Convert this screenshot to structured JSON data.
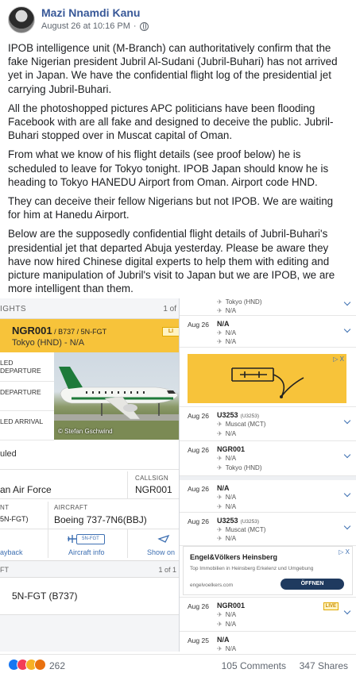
{
  "post": {
    "author": "Mazi Nnamdi Kanu",
    "timestamp": "August 26 at 10:16 PM",
    "paragraphs": [
      "IPOB intelligence unit (M-Branch) can authoritatively confirm that the fake Nigerian president Jubril Al-Sudani (Jubril-Buhari) has not arrived yet in Japan. We have the confidential flight log of the presidential jet carrying Jubril-Buhari.",
      "All the photoshopped pictures APC politicians have been flooding Facebook with are all fake and designed to deceive the public. Jubril-Buhari stopped over in Muscat capital of Oman.",
      "From what we know of his flight details (see proof below) he is scheduled to leave for Tokyo tonight. IPOB Japan should know he is heading to Tokyo HANEDU Airport from Oman. Airport code HND.",
      "They can deceive their fellow Nigerians but not IPOB. We are waiting for him at Hanedu Airport.",
      "Below are the supposedly confidential flight details of Jubril-Buhari's presidential jet that departed Abuja yesterday. Please be aware they have now hired Chinese digital experts to help them with editing and picture manipulation of Jubril's visit to Japan but we are IPOB, we are more intelligent than them."
    ]
  },
  "left_panel": {
    "header_left": "IGHTS",
    "header_right": "1 of",
    "callsign_main": "NGR001",
    "callsign_sub": " / B737 / 5N-FGT",
    "route": "Tokyo (HND) - N/A",
    "live_tag": "LI",
    "time_labels": [
      "LED DEPARTURE",
      "DEPARTURE",
      "LED ARRIVAL"
    ],
    "photo_credit": "© Stefan Gschwind",
    "status": "uled",
    "airline": "an Air Force",
    "callsign_label": "CALLSIGN",
    "callsign_value": "NGR001",
    "nt_label": "NT",
    "nt_value": "5N-FGT)",
    "aircraft_label": "AIRCRAFT",
    "aircraft_value": "Boeing 737-7N6(BBJ)",
    "tab_playback": "ayback",
    "tab_aircraft_info": "Aircraft info",
    "tab_aircraft_icon_text": "5N-FGT",
    "tab_show_on": "Show on",
    "header2_left": "FT",
    "header2_right": "1 of 1",
    "registration": "5N-FGT (B737)"
  },
  "right_panel": {
    "items": [
      {
        "date": "",
        "flight": "",
        "sub": "",
        "lines": [
          "Tokyo (HND)",
          "N/A"
        ]
      },
      {
        "date": "Aug 26",
        "flight": "N/A",
        "sub": "",
        "lines": [
          "N/A",
          "N/A"
        ]
      },
      {
        "date": "Aug 26",
        "flight": "U3253",
        "sub": "(U3253)",
        "lines": [
          "Muscat (MCT)",
          "N/A"
        ]
      },
      {
        "date": "Aug 26",
        "flight": "NGR001",
        "sub": "",
        "lines": [
          "N/A",
          "Tokyo (HND)"
        ]
      },
      {
        "date": "Aug 26",
        "flight": "N/A",
        "sub": "",
        "lines": [
          "N/A",
          "N/A"
        ]
      },
      {
        "date": "Aug 26",
        "flight": "U3253",
        "sub": "(U3253)",
        "lines": [
          "Muscat (MCT)",
          "N/A"
        ]
      },
      {
        "date": "Aug 26",
        "flight": "NGR001",
        "sub": "",
        "lines": [
          "N/A",
          "N/A"
        ],
        "live": "LIVE"
      },
      {
        "date": "Aug 25",
        "flight": "N/A",
        "sub": "",
        "lines": [
          "N/A"
        ]
      }
    ],
    "ad_title": "Engel&Völkers Heinsberg",
    "ad_text": "Top Immobilien in Heinsberg Erkelenz und Umgebung",
    "ad_domain": "engelvoelkers.com",
    "ad_button": "ÖFFNEN",
    "ad_close": "▷ X"
  },
  "footer": {
    "reaction_count": "262",
    "comments": "105 Comments",
    "shares": "347 Shares"
  },
  "colors": {
    "link_blue": "#385898",
    "fr24_yellow": "#f7c33a",
    "fr24_blue": "#3d6fb2"
  }
}
